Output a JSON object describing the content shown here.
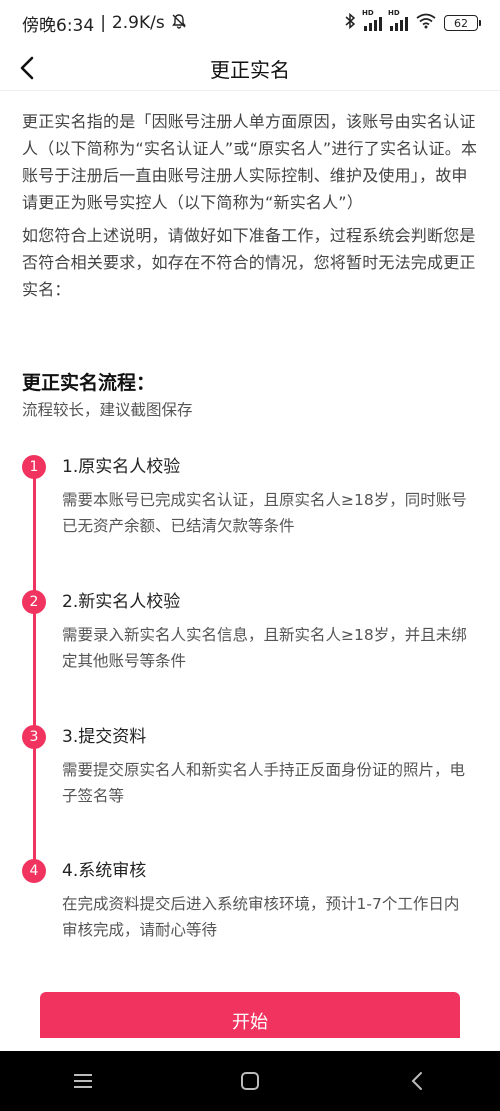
{
  "status_bar": {
    "time": "傍晚6:34",
    "network_speed": "2.9K/s",
    "hd1": "HD",
    "hd2": "HD",
    "battery": "62"
  },
  "nav": {
    "title": "更正实名"
  },
  "intro": {
    "paragraph1": "更正实名指的是「因账号注册人单方面原因，该账号由实名认证人（以下简称为“实名认证人”或“原实名人”进行了实名认证。本账号于注册后一直由账号注册人实际控制、维护及使用」，故申请更正为账号实控人（以下简称为“新实名人”）",
    "paragraph2": "如您符合上述说明，请做好如下准备工作，过程系统会判断您是否符合相关要求，如存在不符合的情况，您将暂时无法完成更正实名："
  },
  "flow": {
    "title": "更正实名流程：",
    "subtitle": "流程较长，建议截图保存",
    "steps": [
      {
        "num": "1",
        "title": "1.原实名人校验",
        "desc": "需要本账号已完成实名认证，且原实名人≥18岁，同时账号已无资产余额、已结清欠款等条件"
      },
      {
        "num": "2",
        "title": "2.新实名人校验",
        "desc": "需要录入新实名人实名信息，且新实名人≥18岁，并且未绑定其他账号等条件"
      },
      {
        "num": "3",
        "title": "3.提交资料",
        "desc": "需要提交原实名人和新实名人手持正反面身份证的照片，电子签名等"
      },
      {
        "num": "4",
        "title": "4.系统审核",
        "desc": "在完成资料提交后进入系统审核环境，预计1-7个工作日内审核完成，请耐心等待"
      }
    ]
  },
  "start_button": {
    "label": "开始"
  },
  "colors": {
    "accent": "#f0345f"
  },
  "icons": {
    "back": "chevron-left-icon",
    "bell_muted": "bell-off-icon",
    "bluetooth": "bluetooth-icon",
    "signal": "signal-icon",
    "wifi": "wifi-icon",
    "battery": "battery-icon",
    "menu": "menu-icon",
    "home": "home-icon",
    "back_nav": "back-nav-icon"
  }
}
